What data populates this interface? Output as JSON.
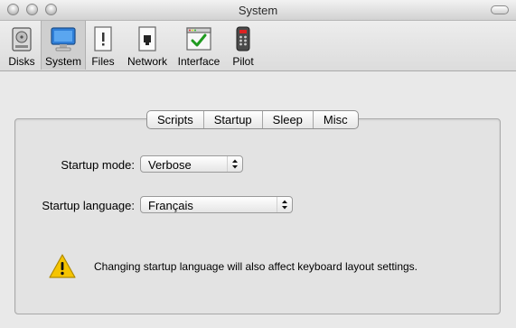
{
  "window": {
    "title": "System"
  },
  "toolbar": {
    "items": [
      {
        "label": "Disks",
        "icon": "disk-icon"
      },
      {
        "label": "System",
        "icon": "monitor-icon",
        "selected": true
      },
      {
        "label": "Files",
        "icon": "file-icon"
      },
      {
        "label": "Network",
        "icon": "network-icon"
      },
      {
        "label": "Interface",
        "icon": "interface-icon"
      },
      {
        "label": "Pilot",
        "icon": "remote-icon"
      }
    ]
  },
  "tabs": {
    "items": [
      {
        "label": "Scripts"
      },
      {
        "label": "Startup",
        "selected": true
      },
      {
        "label": "Sleep"
      },
      {
        "label": "Misc"
      }
    ]
  },
  "startup": {
    "mode_label": "Startup mode:",
    "mode_value": "Verbose",
    "language_label": "Startup language:",
    "language_value": "Français",
    "notice": "Changing startup language will also affect keyboard layout settings."
  },
  "colors": {
    "warning": "#f5c400",
    "check": "#1f9a1f",
    "monitor": "#2f7fd8"
  }
}
